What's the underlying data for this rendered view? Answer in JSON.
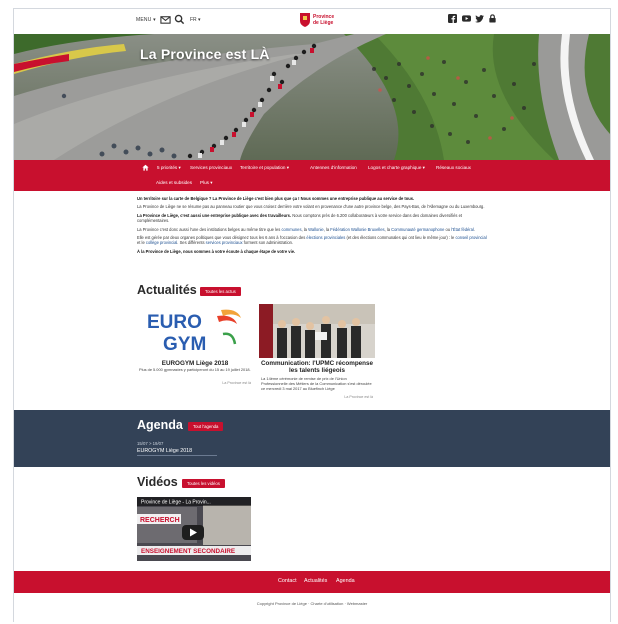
{
  "header": {
    "menu_label": "MENU ▾",
    "lang_label": "FR ▾",
    "logo_line1": "Province",
    "logo_line2": "de Liège"
  },
  "hero": {
    "title": "La Province est LÀ"
  },
  "nav": {
    "items": [
      "🏠",
      "5 priorités ▾",
      "Services provinciaux",
      "Territoire et population ▾",
      "Antennes d'information",
      "Logos et charte graphique ▾",
      "Réseaux sociaux",
      "Aides et subsides",
      "Plus ▾"
    ]
  },
  "intro": {
    "p1": "Un territoire sur la carte de Belgique ? La Province de Liège c'est bien plus que ça ! Nous sommes une entreprise publique au service de tous.",
    "p2": "La Province de Liège ne se résume pas au panneau routier que vous croisez derrière votre volant en provenance d'une autre province belge, des Pays-Bas, de l'Allemagne ou du Luxembourg.",
    "p3_bold": "La Province de Liège, c'est aussi une entreprise publique avec des travailleurs.",
    "p3_rest": " Nous comptons près de 6.200 collaborateurs à votre service dans des domaines diversifiés et complémentaires.",
    "p4_a": "La Province c'est donc aussi l'une des institutions belges au même titre que les ",
    "p4_l1": "communes",
    "p4_b": ", la ",
    "p4_l2": "Wallonie",
    "p4_c": ", la ",
    "p4_l3": "Fédération Wallonie Bruxelles",
    "p4_d": ", la ",
    "p4_l4": "Communauté germanophone",
    "p4_e": " ou ",
    "p4_l5": "l'État fédéral",
    "p4_f": ".",
    "p5_a": "Elle est gérée par deux organes politiques que vous désignez tous les 6 ans à l'occasion des ",
    "p5_l1": "élections provinciales",
    "p5_b": " (et des élections communales qui ont lieu le même jour) : le ",
    "p5_l2": "conseil provincial",
    "p5_c": " et le ",
    "p5_l3": "collège provincial",
    "p5_d": ". Ses différents ",
    "p5_l4": "services provinciaux",
    "p5_e": " forment son administration.",
    "p6": "À la Province de Liège, nous sommes à votre écoute à chaque étape de votre vie."
  },
  "news": {
    "title": "Actualités",
    "all_label": "Toutes les actus",
    "items": [
      {
        "title": "EUROGYM Liège 2018",
        "desc": "Plus de 5.000 gymnastes y participeront du 15 au 19 juillet 2018.",
        "source": "La Province est là"
      },
      {
        "title": "Communication: l'UPMC récompense les talents liégeois",
        "desc": "La 14ème cérémonie de remise de prix de l'Union Professionnelle des Métiers de la Communication s'est déroulée ce mercredi 3 mai 2017 au Bluefinch Liège",
        "source": "La Province est là"
      }
    ],
    "eurogym_line1": "EURO",
    "eurogym_line2": "GYM"
  },
  "agenda": {
    "title": "Agenda",
    "all_label": "Tout l'agenda",
    "date_start": "15/07",
    "date_end": "19/07",
    "event": "EUROGYM Liège 2018"
  },
  "videos": {
    "title": "Vidéos",
    "all_label": "Toutes les vidéos",
    "video_title": "Province de Liège - La Provin...",
    "video_caption1": "RECHERCH",
    "video_caption2": "ENSEIGNEMENT SECONDAIRE"
  },
  "footer": {
    "links": [
      "Contact",
      "Actualités",
      "Agenda"
    ],
    "copyright": "Copyright Province de Liège",
    "charte": "Charte d'utilisation",
    "webmaster": "Webmaster"
  },
  "colors": {
    "brand_red": "#c8102e",
    "agenda_bg": "#334257"
  },
  "icons": [
    "envelope-icon",
    "search-icon",
    "facebook-icon",
    "youtube-icon",
    "twitter-icon",
    "lock-icon",
    "home-icon",
    "play-icon"
  ]
}
